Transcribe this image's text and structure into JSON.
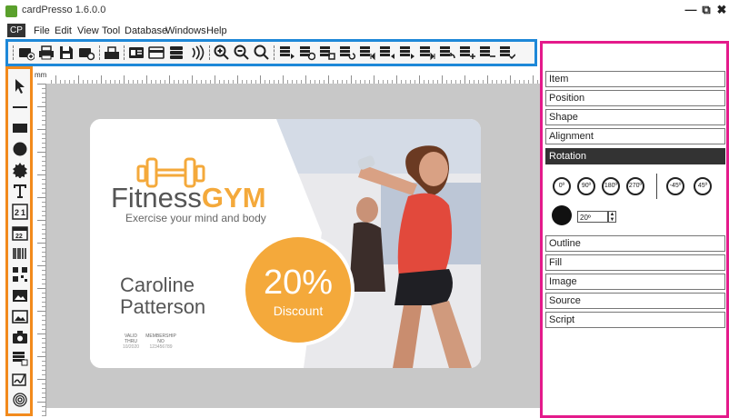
{
  "window": {
    "title": "cardPresso 1.6.0.0",
    "minimize": "—",
    "restore": "⧉",
    "close": "✖"
  },
  "menubar": {
    "badge": "CP",
    "items": [
      "File",
      "Edit",
      "View",
      "Tool",
      "Database",
      "Windows",
      "Help"
    ]
  },
  "ruler": {
    "unit": "mm"
  },
  "card": {
    "brand_part1": "Fitness",
    "brand_part2": "GYM",
    "tagline": "Exercise your mind and body",
    "first_name": "Caroline",
    "last_name": "Patterson",
    "discount_value": "20%",
    "discount_label": "Discount",
    "valid_label1": "VALID",
    "valid_label2": "THRU",
    "valid_value": "10/2020",
    "member_label1": "MEMBERSHIP",
    "member_label2": "NO",
    "member_value": "123456789"
  },
  "panel": {
    "sections_top": [
      "Item",
      "Position",
      "Shape",
      "Alignment"
    ],
    "active_section": "Rotation",
    "rotation_buttons": [
      "0º",
      "90º",
      "180º",
      "270º",
      "-45º",
      "45º"
    ],
    "rotation_value": "20º",
    "sections_bottom": [
      "Outline",
      "Fill",
      "Image",
      "Source",
      "Script"
    ]
  },
  "colors": {
    "toolbar_outline": "#1e88d8",
    "tools_outline": "#f28a1c",
    "panel_outline": "#e41a8b",
    "brand_orange": "#f4a93b"
  }
}
